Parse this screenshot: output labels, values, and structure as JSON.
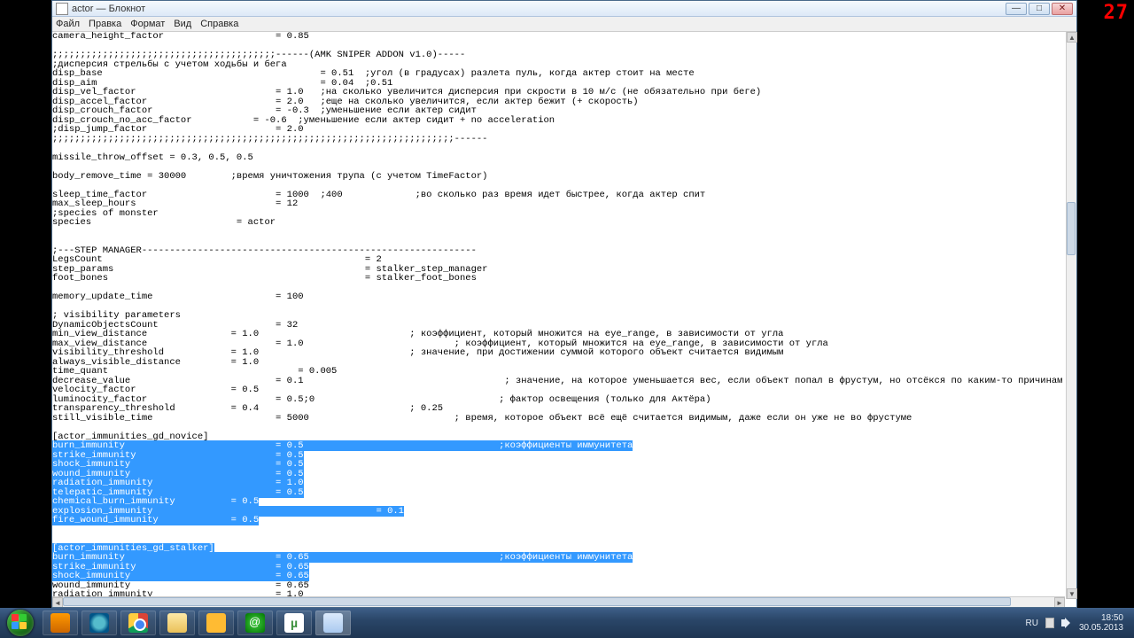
{
  "overlay_number": "27",
  "window": {
    "title": "actor — Блокнот",
    "menus": [
      "Файл",
      "Правка",
      "Формат",
      "Вид",
      "Справка"
    ]
  },
  "editor": {
    "lines_plain_top": [
      "camera_height_factor                    = 0.85",
      "",
      ";;;;;;;;;;;;;;;;;;;;;;;;;;;;;;;;;;;;;;;;------(AMK SNIPER ADDON v1.0)-----",
      ";дисперсия стрельбы с учетом ходьбы и бега",
      "disp_base                                       = 0.51  ;угол (в градусах) разлета пуль, когда актер стоит на месте",
      "disp_aim                                        = 0.04  ;0.51",
      "disp_vel_factor                         = 1.0   ;на сколько увеличится дисперсия при скрости в 10 м/с (не обязательно при беге)",
      "disp_accel_factor                       = 2.0   ;еще на сколько увеличится, если актер бежит (+ скорость)",
      "disp_crouch_factor                      = -0.3  ;уменьшение если актер сидит",
      "disp_crouch_no_acc_factor           = -0.6  ;уменьшение если актер сидит + no acceleration",
      ";disp_jump_factor                       = 2.0",
      ";;;;;;;;;;;;;;;;;;;;;;;;;;;;;;;;;;;;;;;;;;;;;;;;;;;;;;;;;;;;;;;;;;;;;;;;------",
      "",
      "missile_throw_offset = 0.3, 0.5, 0.5",
      "",
      "body_remove_time = 30000        ;время уничтожения трупа (с учетом TimeFactor)",
      "",
      "sleep_time_factor                       = 1000  ;400             ;во сколько раз время идет быстрее, когда актер спит",
      "max_sleep_hours                         = 12",
      ";species of monster",
      "species                          = actor",
      "",
      "",
      ";---STEP MANAGER------------------------------------------------------------",
      "LegsCount                                               = 2",
      "step_params                                             = stalker_step_manager",
      "foot_bones                                              = stalker_foot_bones",
      "",
      "memory_update_time                      = 100",
      "",
      "; visibility parameters",
      "DynamicObjectsCount                     = 32",
      "min_view_distance               = 1.0                           ; коэффициент, который множится на eye_range, в зависимости от угла",
      "max_view_distance                       = 1.0                           ; коэффициент, который множится на eye_range, в зависимости от угла",
      "visibility_threshold            = 1.0                           ; значение, при достижении суммой которого объект считается видимым",
      "always_visible_distance         = 1.0",
      "time_quant                                  = 0.005",
      "decrease_value                          = 0.1                                    ; значение, на которое уменьшается вес, если объект попал в фрустум, но отсёкся по каким-то причинам",
      "velocity_factor                 = 0.5",
      "luminocity_factor                       = 0.5;0                                 ; фактор освещения (только для Актёра)",
      "transparency_threshold          = 0.4                           ; 0.25",
      "still_visible_time                      = 5000                          ; время, которое объект всё ещё считается видимым, даже если он уже не во фрустуме",
      "",
      "[actor_immunities_gd_novice]"
    ],
    "lines_selected_1": [
      "burn_immunity                           = 0.5                                   ;коэффициенты иммунитета",
      "strike_immunity                         = 0.5",
      "shock_immunity                          = 0.5",
      "wound_immunity                          = 0.5",
      "radiation_immunity                      = 1.0",
      "telepatic_immunity                      = 0.5"
    ],
    "line_chem_sel": "chemical_burn_immunity          = 0.5",
    "line_chem_plain_tail": "",
    "lines_selected_2": [
      "                                        = 0.1"
    ],
    "line_explosion_prefix_sel": "explosion_immunity",
    "line_fire_sel": "fire_wound_immunity             = 0.5",
    "lines_plain_gap": [
      "",
      ""
    ],
    "line_stalker_header_sel": "[actor_immunities_gd_stalker]",
    "lines_selected_3": [
      "burn_immunity                           = 0.65                                  ;коэффициенты иммунитета",
      "strike_immunity                         = 0.65",
      "shock_immunity                          = 0.65"
    ],
    "lines_plain_bottom": [
      "wound_immunity                          = 0.65",
      "radiation_immunity                      = 1.0"
    ]
  },
  "taskbar": {
    "lang": "RU",
    "time": "18:50",
    "date": "30.05.2013"
  }
}
